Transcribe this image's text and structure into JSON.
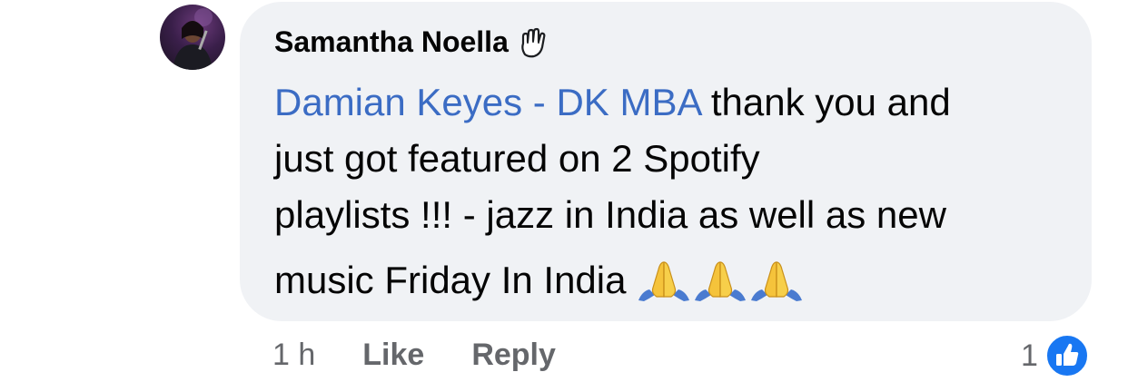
{
  "comment": {
    "author": "Samantha Noella",
    "author_badge_icon": "wave-hand-icon",
    "mention": "Damian Keyes - DK MBA",
    "lines": [
      " thank you and",
      "just got featured on 2 Spotify",
      "playlists !!! - jazz in India as well as  new",
      "music Friday In India"
    ],
    "emoji_icon": "folded-hands-icon",
    "emoji_count": 3
  },
  "footer": {
    "time": "1 h",
    "like_label": "Like",
    "reply_label": "Reply"
  },
  "reactions": {
    "count": "1",
    "icon": "thumbs-up-icon",
    "badge_color": "#1877f2"
  },
  "colors": {
    "bubble": "#f0f2f5",
    "mention": "#3b6cc4",
    "secondary_text": "#65676b"
  }
}
